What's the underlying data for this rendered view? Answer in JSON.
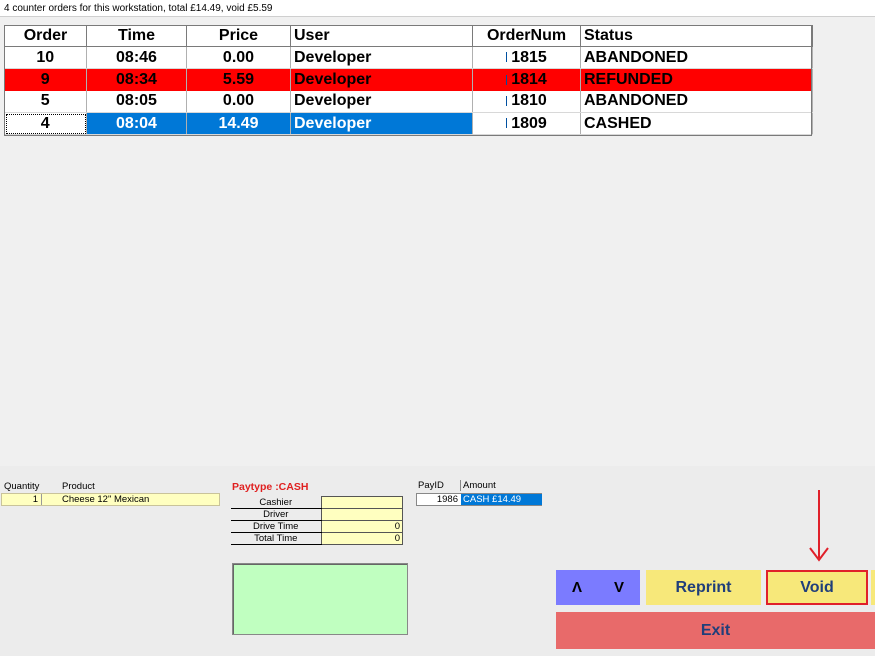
{
  "header": {
    "summary": "4 counter orders for this workstation, total £14.49, void £5.59"
  },
  "orders": {
    "columns": [
      "Order",
      "Time",
      "Price",
      "User",
      "OrderNum",
      "Status"
    ],
    "rows": [
      {
        "order": "10",
        "time": "08:46",
        "price": "0.00",
        "user": "Developer",
        "ordernum": "1815",
        "status": "ABANDONED"
      },
      {
        "order": "9",
        "time": "08:34",
        "price": "5.59",
        "user": "Developer",
        "ordernum": "1814",
        "status": "REFUNDED"
      },
      {
        "order": "5",
        "time": "08:05",
        "price": "0.00",
        "user": "Developer",
        "ordernum": "1810",
        "status": "ABANDONED"
      },
      {
        "order": "4",
        "time": "08:04",
        "price": "14.49",
        "user": "Developer",
        "ordernum": "1809",
        "status": "CASHED"
      }
    ],
    "selected_order": "4",
    "colors": {
      "refunded": "#ff0000",
      "selected": "#0078d7"
    }
  },
  "products": {
    "headers": {
      "quantity": "Quantity",
      "product": "Product"
    },
    "items": [
      {
        "qty": "1",
        "name": "Cheese 12\" Mexican"
      }
    ]
  },
  "payment": {
    "paytype": "Paytype :CASH",
    "fields": [
      {
        "label": "Cashier",
        "value": ""
      },
      {
        "label": "Driver",
        "value": ""
      },
      {
        "label": "Drive Time",
        "value": "0"
      },
      {
        "label": "Total Time",
        "value": "0"
      }
    ]
  },
  "payids": {
    "headers": {
      "payid": "PayID",
      "amount": "Amount"
    },
    "rows": [
      {
        "payid": "1986",
        "amount": "CASH £14.49"
      }
    ]
  },
  "buttons": {
    "up": "Λ",
    "down": "V",
    "reprint": "Reprint",
    "void": "Void",
    "exit": "Exit"
  },
  "annotation": {
    "arrow_color": "#e0202a",
    "target": "void-button"
  }
}
